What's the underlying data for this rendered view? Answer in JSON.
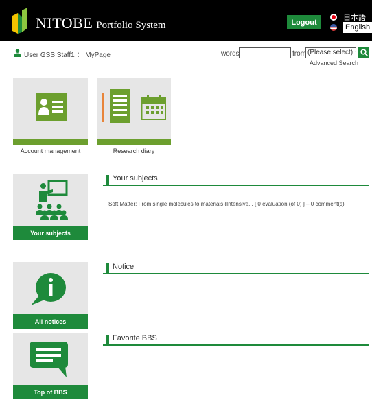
{
  "colors": {
    "header_bg": "#000000",
    "brand_green": "#1e8a3b",
    "tile_green": "#6c9f2e",
    "tile_bg": "#e6e6e6"
  },
  "header": {
    "title_main": "NITOBE",
    "title_sub": "Portfolio System",
    "logout_label": "Logout",
    "lang_ja": "日本語",
    "lang_en": "English"
  },
  "user": {
    "line": "User GSS Staff1 ： MyPage"
  },
  "search": {
    "words_label": "words",
    "words_value": "",
    "from_label": "from",
    "from_selected": "(Please select)",
    "advanced": "Advanced Search"
  },
  "tiles": {
    "account": "Account management",
    "diary": "Research diary"
  },
  "side": {
    "subjects": "Your subjects",
    "notices": "All notices",
    "bbs": "Top of BBS"
  },
  "sections": {
    "subjects_title": "Your subjects",
    "subject_item": "Soft Matter: From single molecules to materials (Intensive... [ 0 evaluation (of 0) ] – 0 comment(s)",
    "notice_title": "Notice",
    "bbs_title": "Favorite BBS"
  },
  "icons": [
    "logo-icon",
    "logout",
    "japan-flag-icon",
    "us-flag-icon",
    "user-icon",
    "search-icon",
    "id-card-icon",
    "notebook-icon",
    "calendar-icon",
    "teacher-class-icon",
    "info-bubble-icon",
    "message-bubble-icon"
  ]
}
